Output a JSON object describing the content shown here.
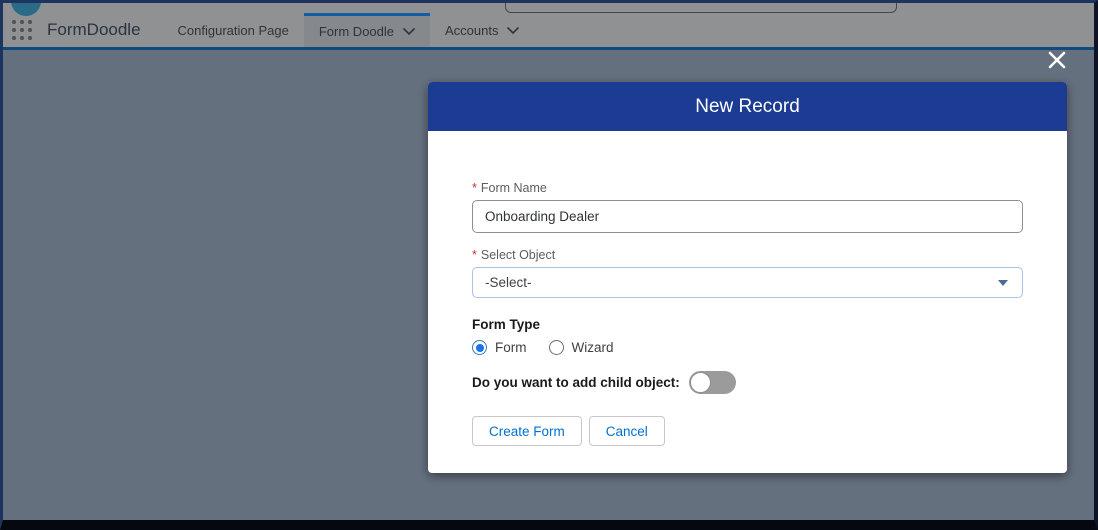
{
  "navbar": {
    "app_title": "FormDoodle",
    "tabs": [
      {
        "label": "Configuration Page",
        "active": false,
        "has_dropdown": false
      },
      {
        "label": "Form Doodle",
        "active": true,
        "has_dropdown": true
      },
      {
        "label": "Accounts",
        "active": false,
        "has_dropdown": true
      }
    ]
  },
  "modal": {
    "title": "New Record",
    "form": {
      "form_name": {
        "label": "Form Name",
        "required": true,
        "value": "Onboarding Dealer"
      },
      "select_object": {
        "label": "Select Object",
        "required": true,
        "value": "-Select-"
      },
      "form_type": {
        "label": "Form Type",
        "options": [
          {
            "label": "Form",
            "selected": true
          },
          {
            "label": "Wizard",
            "selected": false
          }
        ]
      },
      "child_object": {
        "label": "Do you want to add child object:",
        "state": "off"
      }
    },
    "buttons": {
      "create_form": "Create Form",
      "cancel": "Cancel"
    }
  },
  "ui": {
    "required_marker": "*",
    "colors": {
      "modal_header_blue": "#1c3c94",
      "radio_selected_blue": "#1a73e8",
      "button_text_blue": "#0070d2",
      "required_red": "#c23934",
      "overlay_background": "#65707e",
      "navbar_dimmed": "#8f9192",
      "nav_underline_blue": "#114a7e",
      "active_tab_accent": "#0f5ea6"
    }
  }
}
